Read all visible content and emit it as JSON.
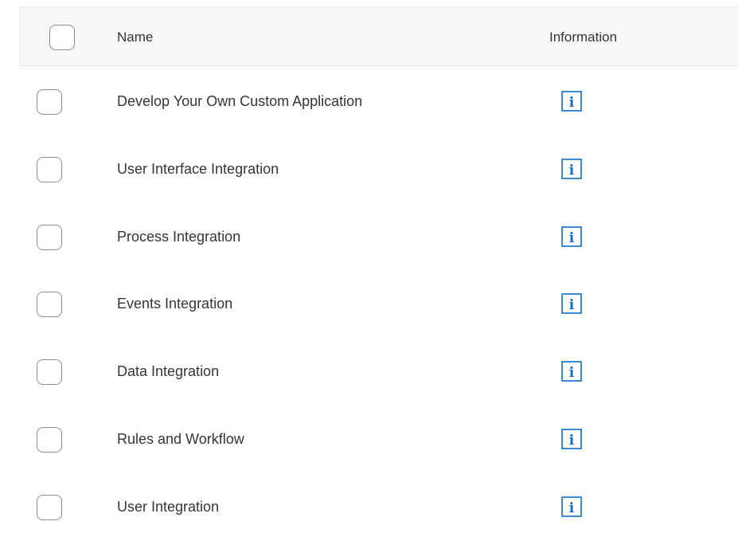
{
  "header": {
    "name_label": "Name",
    "information_label": "Information"
  },
  "rows": [
    {
      "name": "Develop Your Own Custom Application",
      "icon": "info-icon"
    },
    {
      "name": "User Interface Integration",
      "icon": "info-icon"
    },
    {
      "name": "Process Integration",
      "icon": "info-icon"
    },
    {
      "name": "Events Integration",
      "icon": "info-icon"
    },
    {
      "name": "Data Integration",
      "icon": "info-icon"
    },
    {
      "name": "Rules and Workflow",
      "icon": "info-icon"
    },
    {
      "name": "User Integration",
      "icon": "info-icon"
    }
  ],
  "colors": {
    "info_icon": "#0a6ed1",
    "header_bg": "#f7f7f7",
    "text": "#32363a",
    "checkbox_border": "#8a8f94"
  }
}
